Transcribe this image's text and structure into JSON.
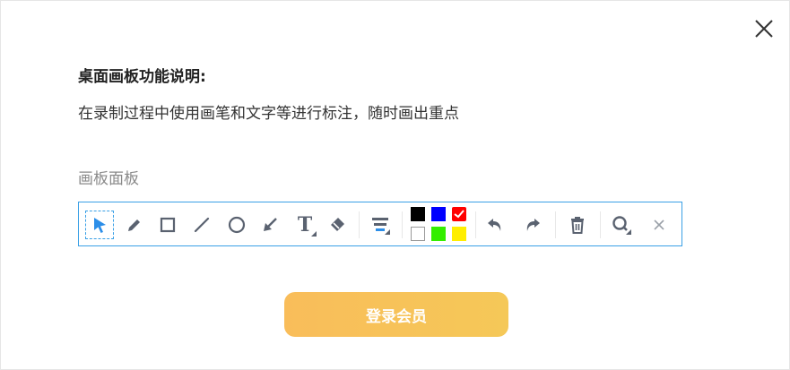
{
  "dialog": {
    "heading": "桌面画板功能说明:",
    "description": "在录制过程中使用画笔和文字等进行标注，随时画出重点",
    "panel_label": "画板面板"
  },
  "toolbar": {
    "tools": [
      {
        "name": "select",
        "icon": "cursor-arrow-icon",
        "selected": true
      },
      {
        "name": "pen",
        "icon": "pen-icon"
      },
      {
        "name": "rectangle",
        "icon": "rectangle-icon"
      },
      {
        "name": "line",
        "icon": "line-icon"
      },
      {
        "name": "circle",
        "icon": "circle-icon"
      },
      {
        "name": "arrow",
        "icon": "arrow-icon"
      },
      {
        "name": "text",
        "icon": "text-icon",
        "text": "T"
      },
      {
        "name": "eraser",
        "icon": "eraser-icon"
      },
      {
        "name": "line-width",
        "icon": "line-width-icon"
      },
      {
        "name": "undo",
        "icon": "undo-icon"
      },
      {
        "name": "redo",
        "icon": "redo-icon"
      },
      {
        "name": "delete",
        "icon": "trash-icon"
      },
      {
        "name": "zoom",
        "icon": "magnifier-icon"
      },
      {
        "name": "close",
        "icon": "close-icon"
      }
    ],
    "colors": {
      "top": [
        "#000000",
        "#0000ff",
        "#ff0000"
      ],
      "bottom": [
        "#ffffff",
        "#33ee00",
        "#ffee00"
      ],
      "selected": "#ff0000"
    },
    "accent": "#3aa0e6",
    "icon_color": "#5a6270"
  },
  "login_button": {
    "label": "登录会员",
    "color": "#f8c155"
  }
}
